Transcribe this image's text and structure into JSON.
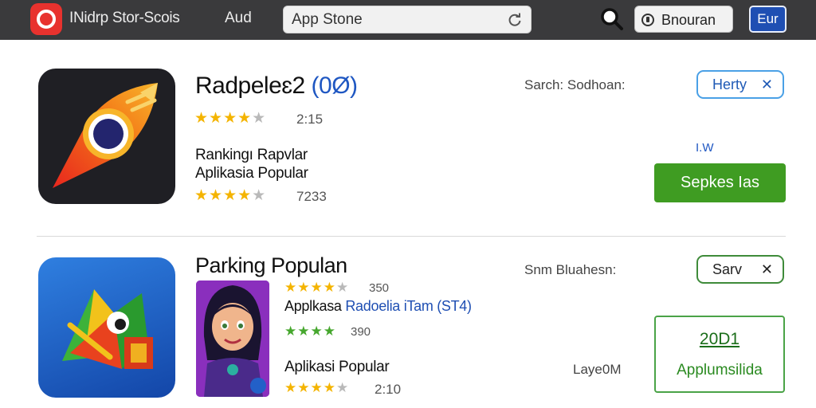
{
  "header": {
    "app_title": "INidrp Stor-Scois",
    "menu_item": "Aud",
    "search": {
      "value": "",
      "placeholder": "App Stone"
    },
    "signin_label": "Bnouran",
    "lang_label": "Eur"
  },
  "items": [
    {
      "name_main": "Radpeleɛ2 ",
      "name_accent": "(0Ø)",
      "rating_count": "2:15",
      "line1": "Rankingı Rapvlar",
      "line2": "Aplikasia Popular",
      "rating_count2": "7233",
      "meta": "Sarch: Sodhoan:",
      "chip_label": "Herty",
      "small_label": "I.W",
      "action_label": "Sepkes Ias",
      "colors": {
        "action": "#3f9c22",
        "chip_border": "#4aa0e6"
      }
    },
    {
      "name": "Parking  Populan",
      "rating_count": "350",
      "line1_main": "Applkasa ",
      "line1_accent": "Radoelia iTam (ST4)",
      "rating_count2": "390",
      "line2": "Aplikasi Popular",
      "rating_count3": "2:10",
      "meta": "Snm Bluahesn:",
      "chip_label": "Sarv",
      "side_label": "Laye0M",
      "card_number": "20D1",
      "card_label": "Applumsilida",
      "colors": {
        "card_border": "#4aa347",
        "chip_border": "#3f8b3a"
      }
    }
  ],
  "glyphs": {
    "stars4": "★★★★",
    "stars4b": "★★★★",
    "star_off": "★",
    "close": "✕"
  },
  "icons": [
    "app-logo-icon",
    "refresh-icon",
    "search-icon",
    "info-icon",
    "rocket-app-icon",
    "bird-app-icon",
    "character-portrait",
    "close-icon"
  ]
}
